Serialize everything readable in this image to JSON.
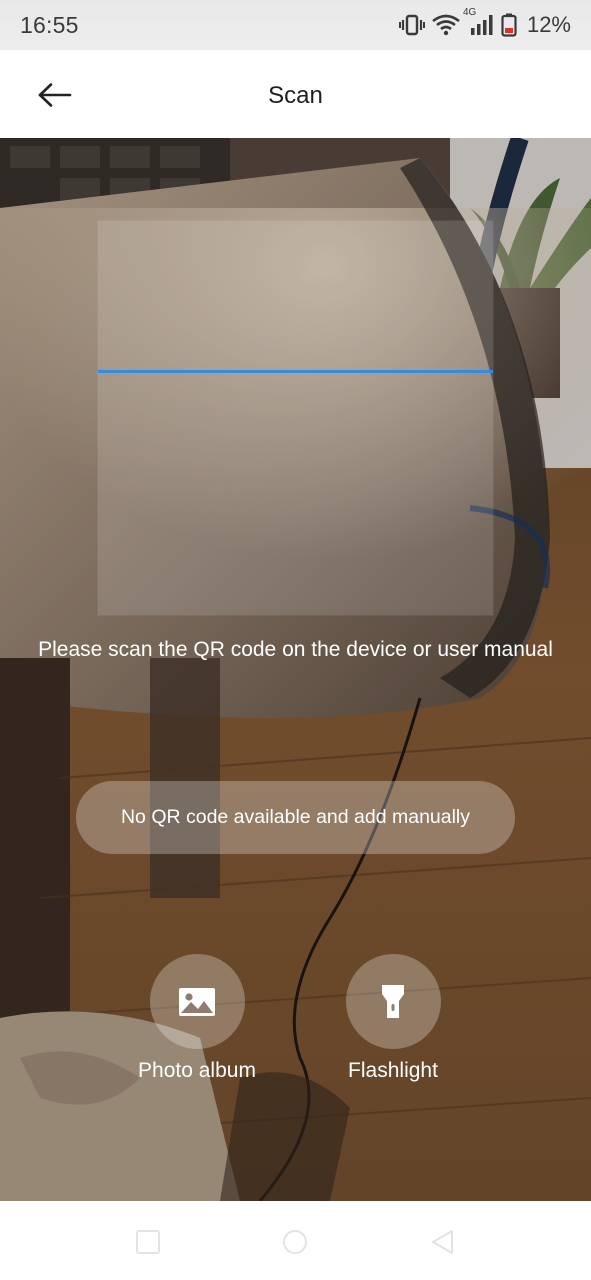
{
  "status_bar": {
    "time": "16:55",
    "network_label": "4G",
    "battery_percent": "12%"
  },
  "header": {
    "title": "Scan",
    "back_icon": "arrow-left-icon"
  },
  "scanner": {
    "instruction": "Please scan the QR code on the device or user manual",
    "scan_line_color": "#2f8de4",
    "manual_button_label": "No QR code available and add manually"
  },
  "actions": {
    "photo_album": {
      "label": "Photo album",
      "icon": "image-icon"
    },
    "flashlight": {
      "label": "Flashlight",
      "icon": "flashlight-icon"
    }
  },
  "nav_bar": {
    "recents_icon": "square-icon",
    "home_icon": "circle-icon",
    "back_icon": "triangle-back-icon"
  }
}
